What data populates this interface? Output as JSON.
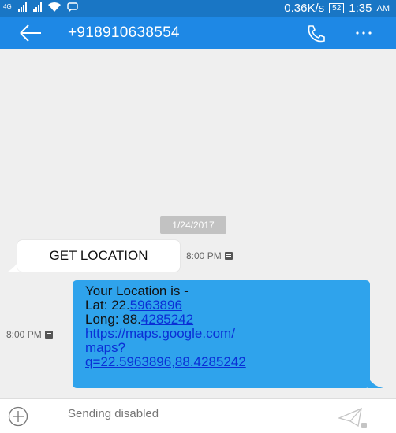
{
  "status_bar": {
    "network_type": "4G",
    "speed": "0.36K/s",
    "battery": "52",
    "time": "1:35",
    "ampm": "AM"
  },
  "header": {
    "contact": "+918910638554",
    "icons": {
      "back": "back-arrow-icon",
      "call": "phone-icon",
      "more": "more-options-icon"
    }
  },
  "thread": {
    "date": "1/24/2017",
    "messages": [
      {
        "direction": "incoming",
        "text": "GET LOCATION",
        "time": "8:00 PM"
      },
      {
        "direction": "outgoing",
        "time": "8:00 PM",
        "line1": "Your Location is -",
        "lat_label": "Lat: 22.",
        "lat_link": "5963896",
        "long_label": "Long: 88.",
        "long_link": "4285242",
        "url_line1": "https://maps.google.com/",
        "url_line2": "maps?",
        "url_line3": "q=22.5963896,88.4285242"
      }
    ]
  },
  "compose": {
    "placeholder": "Sending disabled",
    "icons": {
      "attach": "plus-circle-icon",
      "send": "send-icon"
    }
  },
  "colors": {
    "status_bar": "#1976c5",
    "app_bar": "#1e88e5",
    "outgoing_bubble": "#2fa3ec",
    "link": "#0a2fd6"
  }
}
